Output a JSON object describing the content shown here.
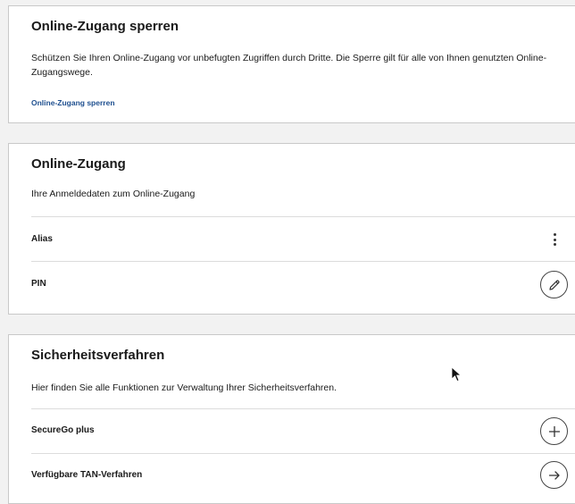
{
  "lock_card": {
    "title": "Online-Zugang sperren",
    "description": "Schützen Sie Ihren Online-Zugang vor unbefugten Zugriffen durch Dritte. Die Sperre gilt für alle von Ihnen genutzten Online-Zugangswege.",
    "link_label": "Online-Zugang sperren"
  },
  "access_card": {
    "title": "Online-Zugang",
    "subtitle": "Ihre Anmeldedaten zum Online-Zugang",
    "rows": [
      {
        "label": "Alias",
        "action_icon": "more-vertical-icon"
      },
      {
        "label": "PIN",
        "action_icon": "pencil-icon"
      }
    ]
  },
  "security_card": {
    "title": "Sicherheitsverfahren",
    "subtitle": "Hier finden Sie alle Funktionen zur Verwaltung Ihrer Sicherheitsverfahren.",
    "rows": [
      {
        "label": "SecureGo plus",
        "action_icon": "plus-icon"
      },
      {
        "label": "Verfügbare TAN-Verfahren",
        "action_icon": "arrow-right-icon"
      }
    ]
  },
  "colors": {
    "background": "#f2f2f2",
    "card": "#ffffff",
    "link": "#1e4f8f",
    "text": "#1a1a1a",
    "divider": "#dcdcdc"
  }
}
